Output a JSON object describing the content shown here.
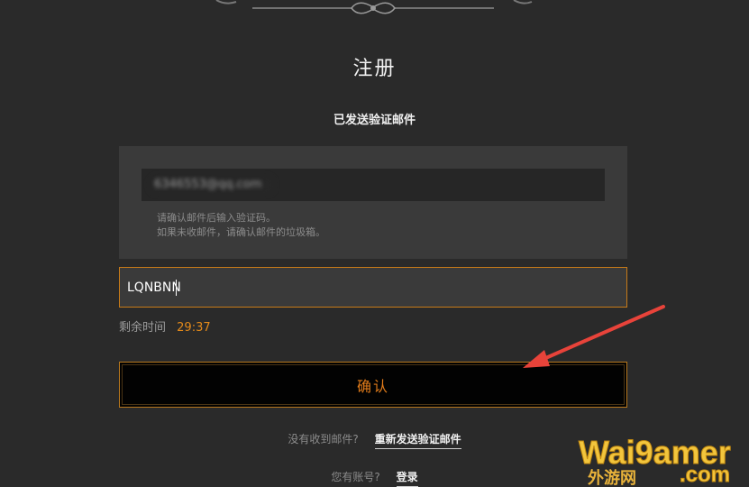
{
  "page": {
    "title": "注册",
    "subtitle": "已发送验证邮件"
  },
  "email_panel": {
    "email_value": "6346553@qq.com",
    "hint_line1": "请确认邮件后输入验证码。",
    "hint_line2": "如果未收邮件，请确认邮件的垃圾箱。"
  },
  "code_input": {
    "value": "LQNBNN"
  },
  "timer": {
    "label": "剩余时间",
    "value": "29:37"
  },
  "confirm_button": {
    "label": "确认"
  },
  "resend": {
    "prompt": "没有收到邮件?",
    "link": "重新发送验证邮件"
  },
  "login": {
    "prompt": "您有账号?",
    "link": "登录"
  },
  "watermark": {
    "brand": "Wai9amer",
    "domain": ".com",
    "chinese": "外游网"
  },
  "colors": {
    "accent": "#e48a1a",
    "background": "#2a2a2a",
    "panel": "#3a3a3a",
    "annotation_arrow": "#e8433a"
  }
}
